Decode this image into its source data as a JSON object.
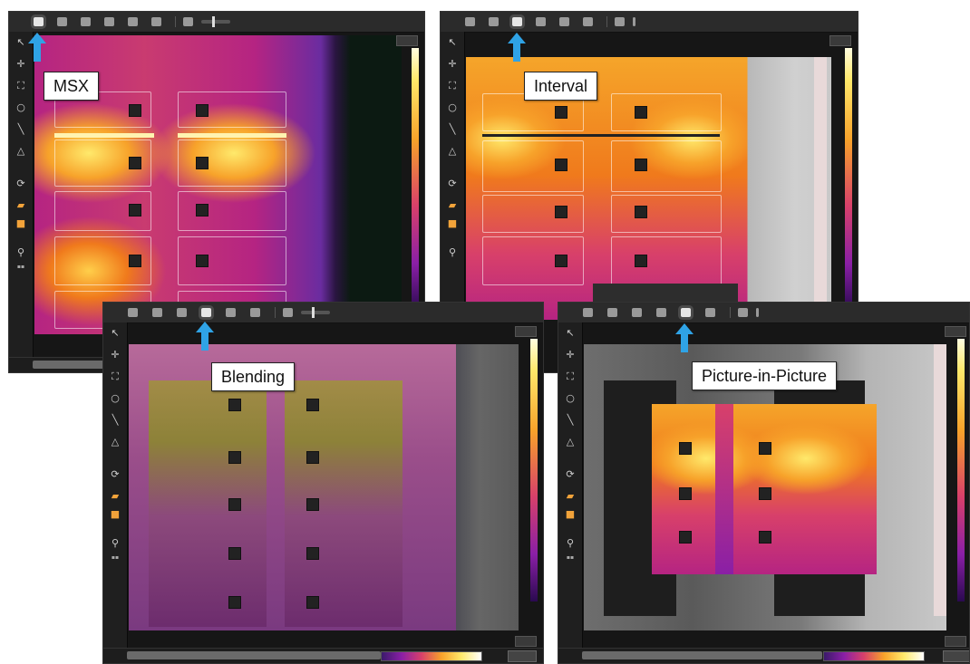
{
  "panels": [
    {
      "id": "msx",
      "label": "MSX",
      "selected_mode_index": 0
    },
    {
      "id": "interval",
      "label": "Interval",
      "selected_mode_index": 2
    },
    {
      "id": "blending",
      "label": "Blending",
      "selected_mode_index": 3
    },
    {
      "id": "pip",
      "label": "Picture-in-Picture",
      "selected_mode_index": 4
    }
  ],
  "toolbar": {
    "mode_icons": [
      "thermal-mode-icon",
      "msx-mode-icon",
      "blending-mode-icon",
      "interval-mode-icon",
      "pip-mode-icon",
      "photo-mode-icon"
    ],
    "extra_icon": "settings-icon"
  },
  "sidebar_tools": [
    "select-tool-icon",
    "spot-tool-icon",
    "box-tool-icon",
    "circle-tool-icon",
    "line-tool-icon",
    "delta-tool-icon",
    "rotate-icon",
    "palette-icon",
    "color-icon",
    "zoom-icon"
  ],
  "colors": {
    "arrow": "#2fa3e6",
    "ironbow_hot": "#ffe96b",
    "ironbow_mid": "#f07a1c",
    "ironbow_cool": "#8a1fa6",
    "ironbow_cold": "#3a1a6a"
  }
}
